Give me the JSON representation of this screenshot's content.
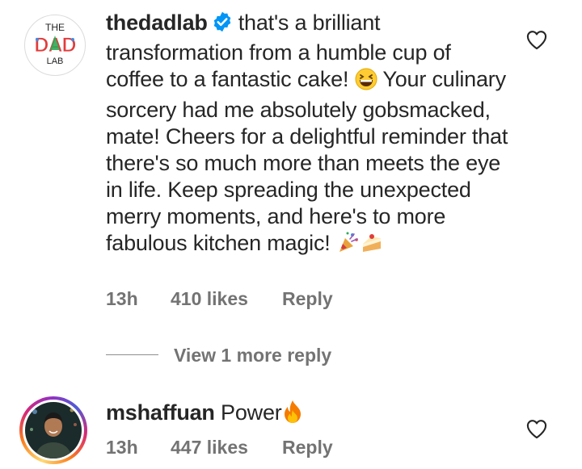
{
  "comments": [
    {
      "username": "thedadlab",
      "verified": true,
      "avatar": "the-dad-lab-logo",
      "avatar_text": {
        "top": "THE",
        "middle": "DAD",
        "bottom": "LAB"
      },
      "text_parts": [
        "that's a brilliant transformation from a humble cup of coffee to a fantastic cake! ",
        " Your culinary sorcery had me absolutely gobsmacked, mate! Cheers for a delightful reminder that there's so much more than meets the eye in life. Keep spreading the unexpected merry moments, and here's to more fabulous kitchen magic! "
      ],
      "emojis": [
        "grinning-face-emoji",
        "party-popper-emoji",
        "cake-slice-emoji"
      ],
      "time": "13h",
      "likes": "410 likes",
      "reply_label": "Reply",
      "view_more_label": "View 1 more reply"
    },
    {
      "username": "mshaffuan",
      "verified": false,
      "avatar": "user-photo-avatar",
      "text": "Power",
      "emojis": [
        "fire-emoji"
      ],
      "time": "13h",
      "likes": "447 likes",
      "reply_label": "Reply"
    }
  ],
  "icons": {
    "like": "heart-outline-icon",
    "verified": "verified-badge-icon"
  },
  "colors": {
    "verified_blue": "#0095f6",
    "meta_gray": "#737373",
    "text": "#262626"
  }
}
